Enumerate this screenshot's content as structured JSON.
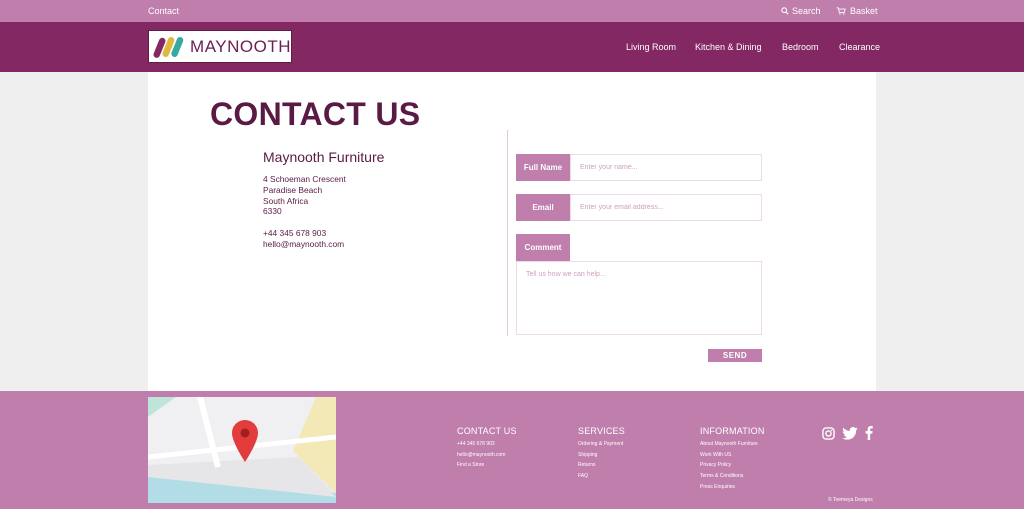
{
  "topbar": {
    "contact": "Contact",
    "search": "Search",
    "basket": "Basket"
  },
  "brand": {
    "name": "MAYNOOTH",
    "colors": {
      "primary": "#832863",
      "accent": "#bf7eab",
      "title": "#5a1a44"
    }
  },
  "nav": {
    "items": [
      {
        "label": "Living Room"
      },
      {
        "label": "Kitchen & Dining"
      },
      {
        "label": "Bedroom"
      },
      {
        "label": "Clearance"
      }
    ]
  },
  "page": {
    "title": "CONTACT US"
  },
  "address": {
    "company": "Maynooth Furniture",
    "lines": [
      "4 Schoeman Crescent",
      "Paradise Beach",
      "South Africa",
      "6330"
    ],
    "phone": "+44 345 678 903",
    "email": "hello@maynooth.com"
  },
  "form": {
    "name_label": "Full Name",
    "name_placeholder": "Enter your name...",
    "email_label": "Email",
    "email_placeholder": "Enter your email address...",
    "comment_label": "Comment",
    "comment_placeholder": "Tell us how we can help...",
    "send_label": "SEND"
  },
  "footer": {
    "contact": {
      "heading": "CONTACT US",
      "links": [
        "+44 345 678 903",
        "hello@maynooth.com",
        "Find a Store"
      ]
    },
    "services": {
      "heading": "SERVICES",
      "links": [
        "Ordering & Payment",
        "Shipping",
        "Returns",
        "FAQ"
      ]
    },
    "information": {
      "heading": "INFORMATION",
      "links": [
        "About Maynooth Furniture",
        "Work With US",
        "Privacy Policy",
        "Terms & Conditions",
        "Press Enquiries"
      ]
    },
    "social_icons": [
      "instagram-icon",
      "twitter-icon",
      "facebook-icon"
    ],
    "copyright": "© Toemeya Designs"
  }
}
